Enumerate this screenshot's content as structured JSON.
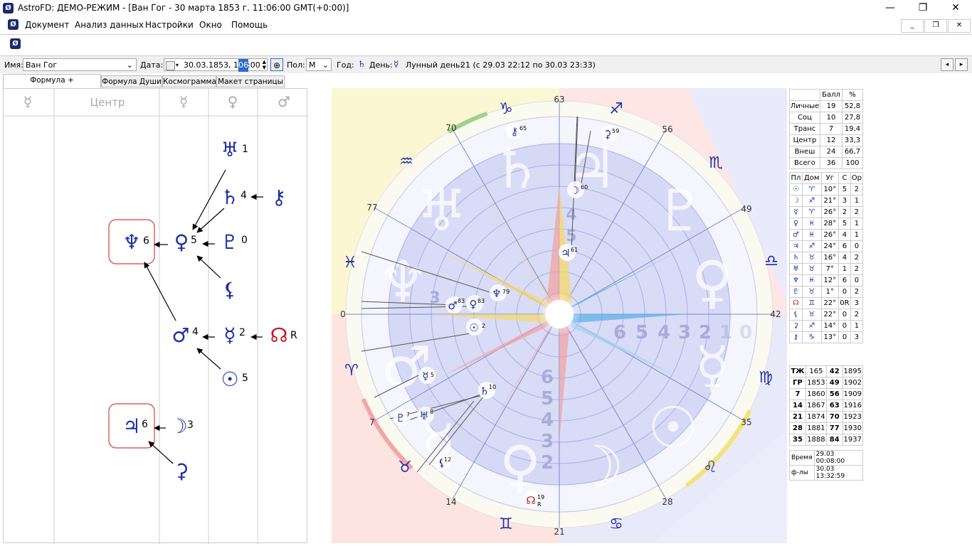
{
  "window": {
    "title": "AstroFD: ДЕМО-РЕЖИМ - [Ван Гог - 30 марта 1853 г. 11:06:00 GMT(+0:00)]",
    "minimize": "—",
    "maximize": "❐",
    "close": "✕"
  },
  "menu": [
    "Документ",
    "Анализ данных",
    "Настройки",
    "Окно",
    "Помощь"
  ],
  "params": {
    "name_label": "Имя:",
    "name_value": "Ван Гог",
    "date_label": "Дата:",
    "date_value": "30.03.1853, 11:",
    "date_minutes": "06",
    "date_seconds": ":00",
    "gender_label": "Пол:",
    "gender_value": "М",
    "year_label": "Год:",
    "day_label": "День:",
    "lunar_label": "Лунный день:",
    "lunar_value": "21 (с 29.03 22:12 по 30.03 23:33)"
  },
  "tabs": [
    "Формула + Космограмма",
    "Формула Души",
    "Космограмма",
    "Макет страницы"
  ],
  "formula": {
    "columns": [
      "☿",
      "Центр",
      "☿",
      "♀",
      "♂"
    ],
    "nodes": [
      {
        "glyph": "♅",
        "num": "1"
      },
      {
        "glyph": "♄",
        "num": "4"
      },
      {
        "glyph": "⚷",
        "num": ""
      },
      {
        "glyph": "♆",
        "num": "6"
      },
      {
        "glyph": "♀",
        "num": "5"
      },
      {
        "glyph": "♇",
        "num": "0"
      },
      {
        "glyph": "⚸",
        "num": ""
      },
      {
        "glyph": "♂",
        "num": "4"
      },
      {
        "glyph": "☿",
        "num": "2"
      },
      {
        "glyph": "☊",
        "num": "R"
      },
      {
        "glyph": "☉",
        "num": "5"
      },
      {
        "glyph": "♃",
        "num": "6"
      },
      {
        "glyph": "☽",
        "num": "3"
      },
      {
        "glyph": "⚳",
        "num": ""
      }
    ]
  },
  "chart": {
    "outer_degrees": [
      "63",
      "56",
      "49",
      "42",
      "35",
      "28",
      "21",
      "14",
      "7",
      "0",
      "77",
      "70"
    ],
    "zodiac": [
      "♑",
      "♐",
      "♏",
      "♎",
      "♍",
      "♌",
      "♋",
      "♊",
      "♉",
      "♈",
      "♓",
      "♒"
    ],
    "planets": [
      {
        "glyph": "⚷",
        "num": "65"
      },
      {
        "glyph": "⚳",
        "num": "59"
      },
      {
        "glyph": "☽",
        "num": "60"
      },
      {
        "glyph": "♃",
        "num": "61"
      },
      {
        "glyph": "♆",
        "num": "79"
      },
      {
        "glyph": "♂",
        "num": "83"
      },
      {
        "glyph": "♀",
        "num": "83"
      },
      {
        "glyph": "☉",
        "num": "2"
      },
      {
        "glyph": "☿",
        "num": "5"
      },
      {
        "glyph": "♄",
        "num": "10"
      },
      {
        "glyph": "♇",
        "num": "7"
      },
      {
        "glyph": "♅",
        "num": "8"
      },
      {
        "glyph": "⚸",
        "num": "12"
      },
      {
        "glyph": "☊",
        "num": "19"
      }
    ],
    "retro_mark": "R",
    "scale_right": [
      "6",
      "5",
      "4",
      "3",
      "2",
      "1",
      "0"
    ],
    "scale_bottom": [
      "6",
      "5",
      "4",
      "3",
      "2"
    ],
    "scale_top": [
      "4",
      "5"
    ],
    "scale_left": [
      "3"
    ]
  },
  "scores": {
    "header": [
      "",
      "Балл",
      "%"
    ],
    "rows": [
      [
        "Личные",
        "19",
        "52,8"
      ],
      [
        "Соц",
        "10",
        "27,8"
      ],
      [
        "Транс",
        "7",
        "19,4"
      ],
      [
        "Центр",
        "12",
        "33,3"
      ],
      [
        "Внеш",
        "24",
        "66,7"
      ],
      [
        "Всего",
        "36",
        "100"
      ]
    ]
  },
  "planets_table": {
    "header": [
      "Пл",
      "Дом",
      "Уг",
      "С",
      "Ор"
    ],
    "rows": [
      [
        "☉",
        "♈",
        "10°",
        "5",
        "2"
      ],
      [
        "☽",
        "♐",
        "21°",
        "3",
        "1"
      ],
      [
        "☿",
        "♈",
        "26°",
        "2",
        "2"
      ],
      [
        "♀",
        "♓",
        "28°",
        "5",
        "1"
      ],
      [
        "♂",
        "♓",
        "26°",
        "4",
        "1"
      ],
      [
        "♃",
        "♐",
        "24°",
        "6",
        "0"
      ],
      [
        "♄",
        "♉",
        "16°",
        "4",
        "2"
      ],
      [
        "♅",
        "♉",
        "7°",
        "1",
        "2"
      ],
      [
        "♆",
        "♓",
        "12°",
        "6",
        "0"
      ],
      [
        "♇",
        "♉",
        "1°",
        "0",
        "2"
      ],
      [
        "☊",
        "♊",
        "22°",
        "0R",
        "3"
      ],
      [
        "⚸",
        "♉",
        "22°",
        "0",
        "2"
      ],
      [
        "⚳",
        "♐",
        "14°",
        "0",
        "1"
      ],
      [
        "⚷",
        "♑",
        "13°",
        "0",
        "3"
      ]
    ]
  },
  "years_table": {
    "rows": [
      [
        "ТЖ",
        "165",
        "42",
        "1895"
      ],
      [
        "ГР",
        "1853",
        "49",
        "1902"
      ],
      [
        "7",
        "1860",
        "56",
        "1909"
      ],
      [
        "14",
        "1867",
        "63",
        "1916"
      ],
      [
        "21",
        "1874",
        "70",
        "1923"
      ],
      [
        "28",
        "1881",
        "77",
        "1930"
      ],
      [
        "35",
        "1888",
        "84",
        "1937"
      ]
    ]
  },
  "time_info": {
    "time_label": "Время",
    "time_value": "29.03 00:08:00",
    "formula_label": "ф-лы",
    "formula_value": "30.03 13:32:59"
  },
  "colors": {
    "planet_blue": "#1d2fa6",
    "node_red": "#c0151d",
    "highlight_box": "#d04040",
    "ring_inner": "#cfd3f5"
  }
}
